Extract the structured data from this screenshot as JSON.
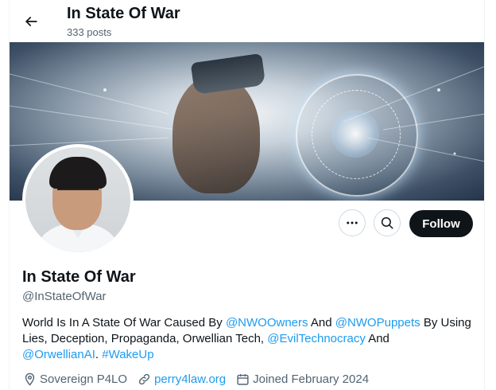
{
  "header": {
    "title": "In State Of War",
    "post_count": "333 posts"
  },
  "profile": {
    "name": "In State Of War",
    "handle": "@InStateOfWar",
    "follow_label": "Follow",
    "bio": {
      "t1": "World Is In A State Of War Caused By ",
      "m1": "@NWOOwners",
      "t2": " And ",
      "m2": "@NWOPuppets",
      "t3": " By Using Lies, Deception, Propaganda, Orwellian Tech, ",
      "m3": "@EvilTechnocracy",
      "t4": " And ",
      "m4": "@OrwellianAI",
      "t5": ". ",
      "h1": "#WakeUp"
    },
    "location": "Sovereign P4LO",
    "website": "perry4law.org",
    "joined": "Joined February 2024"
  },
  "icons": {
    "back": "arrow-left-icon",
    "more": "more-icon",
    "search": "search-icon",
    "location": "location-pin-icon",
    "link": "link-icon",
    "calendar": "calendar-icon"
  },
  "colors": {
    "accent": "#1d9bf0",
    "primary_text": "#0f1419",
    "secondary_text": "#536471",
    "follow_bg": "#0f1419"
  }
}
